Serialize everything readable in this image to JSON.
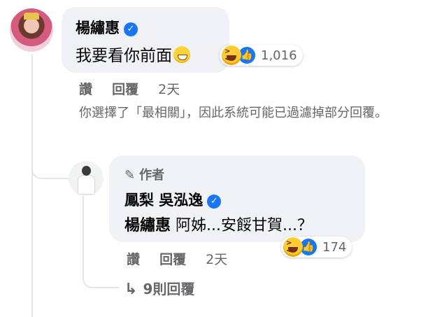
{
  "main_comment": {
    "author": "楊繡惠",
    "text": "我要看你前面",
    "reaction_count": "1,016",
    "actions": {
      "like": "讚",
      "reply": "回覆",
      "time": "2天"
    }
  },
  "filter_notice": "你選擇了「最相關」，因此系統可能已過濾掉部分回覆。",
  "reply_comment": {
    "author_badge": "作者",
    "author": "鳳梨 吳泓逸",
    "tagged_user": "楊繡惠",
    "text": "阿姊...安餒甘賀...？",
    "reaction_count": "174",
    "actions": {
      "like": "讚",
      "reply": "回覆",
      "time": "2天"
    }
  },
  "more_replies_label": "9則回覆",
  "colors": {
    "verified": "#1877f2",
    "bubble": "#f0f2f5",
    "meta_text": "#65676b"
  }
}
